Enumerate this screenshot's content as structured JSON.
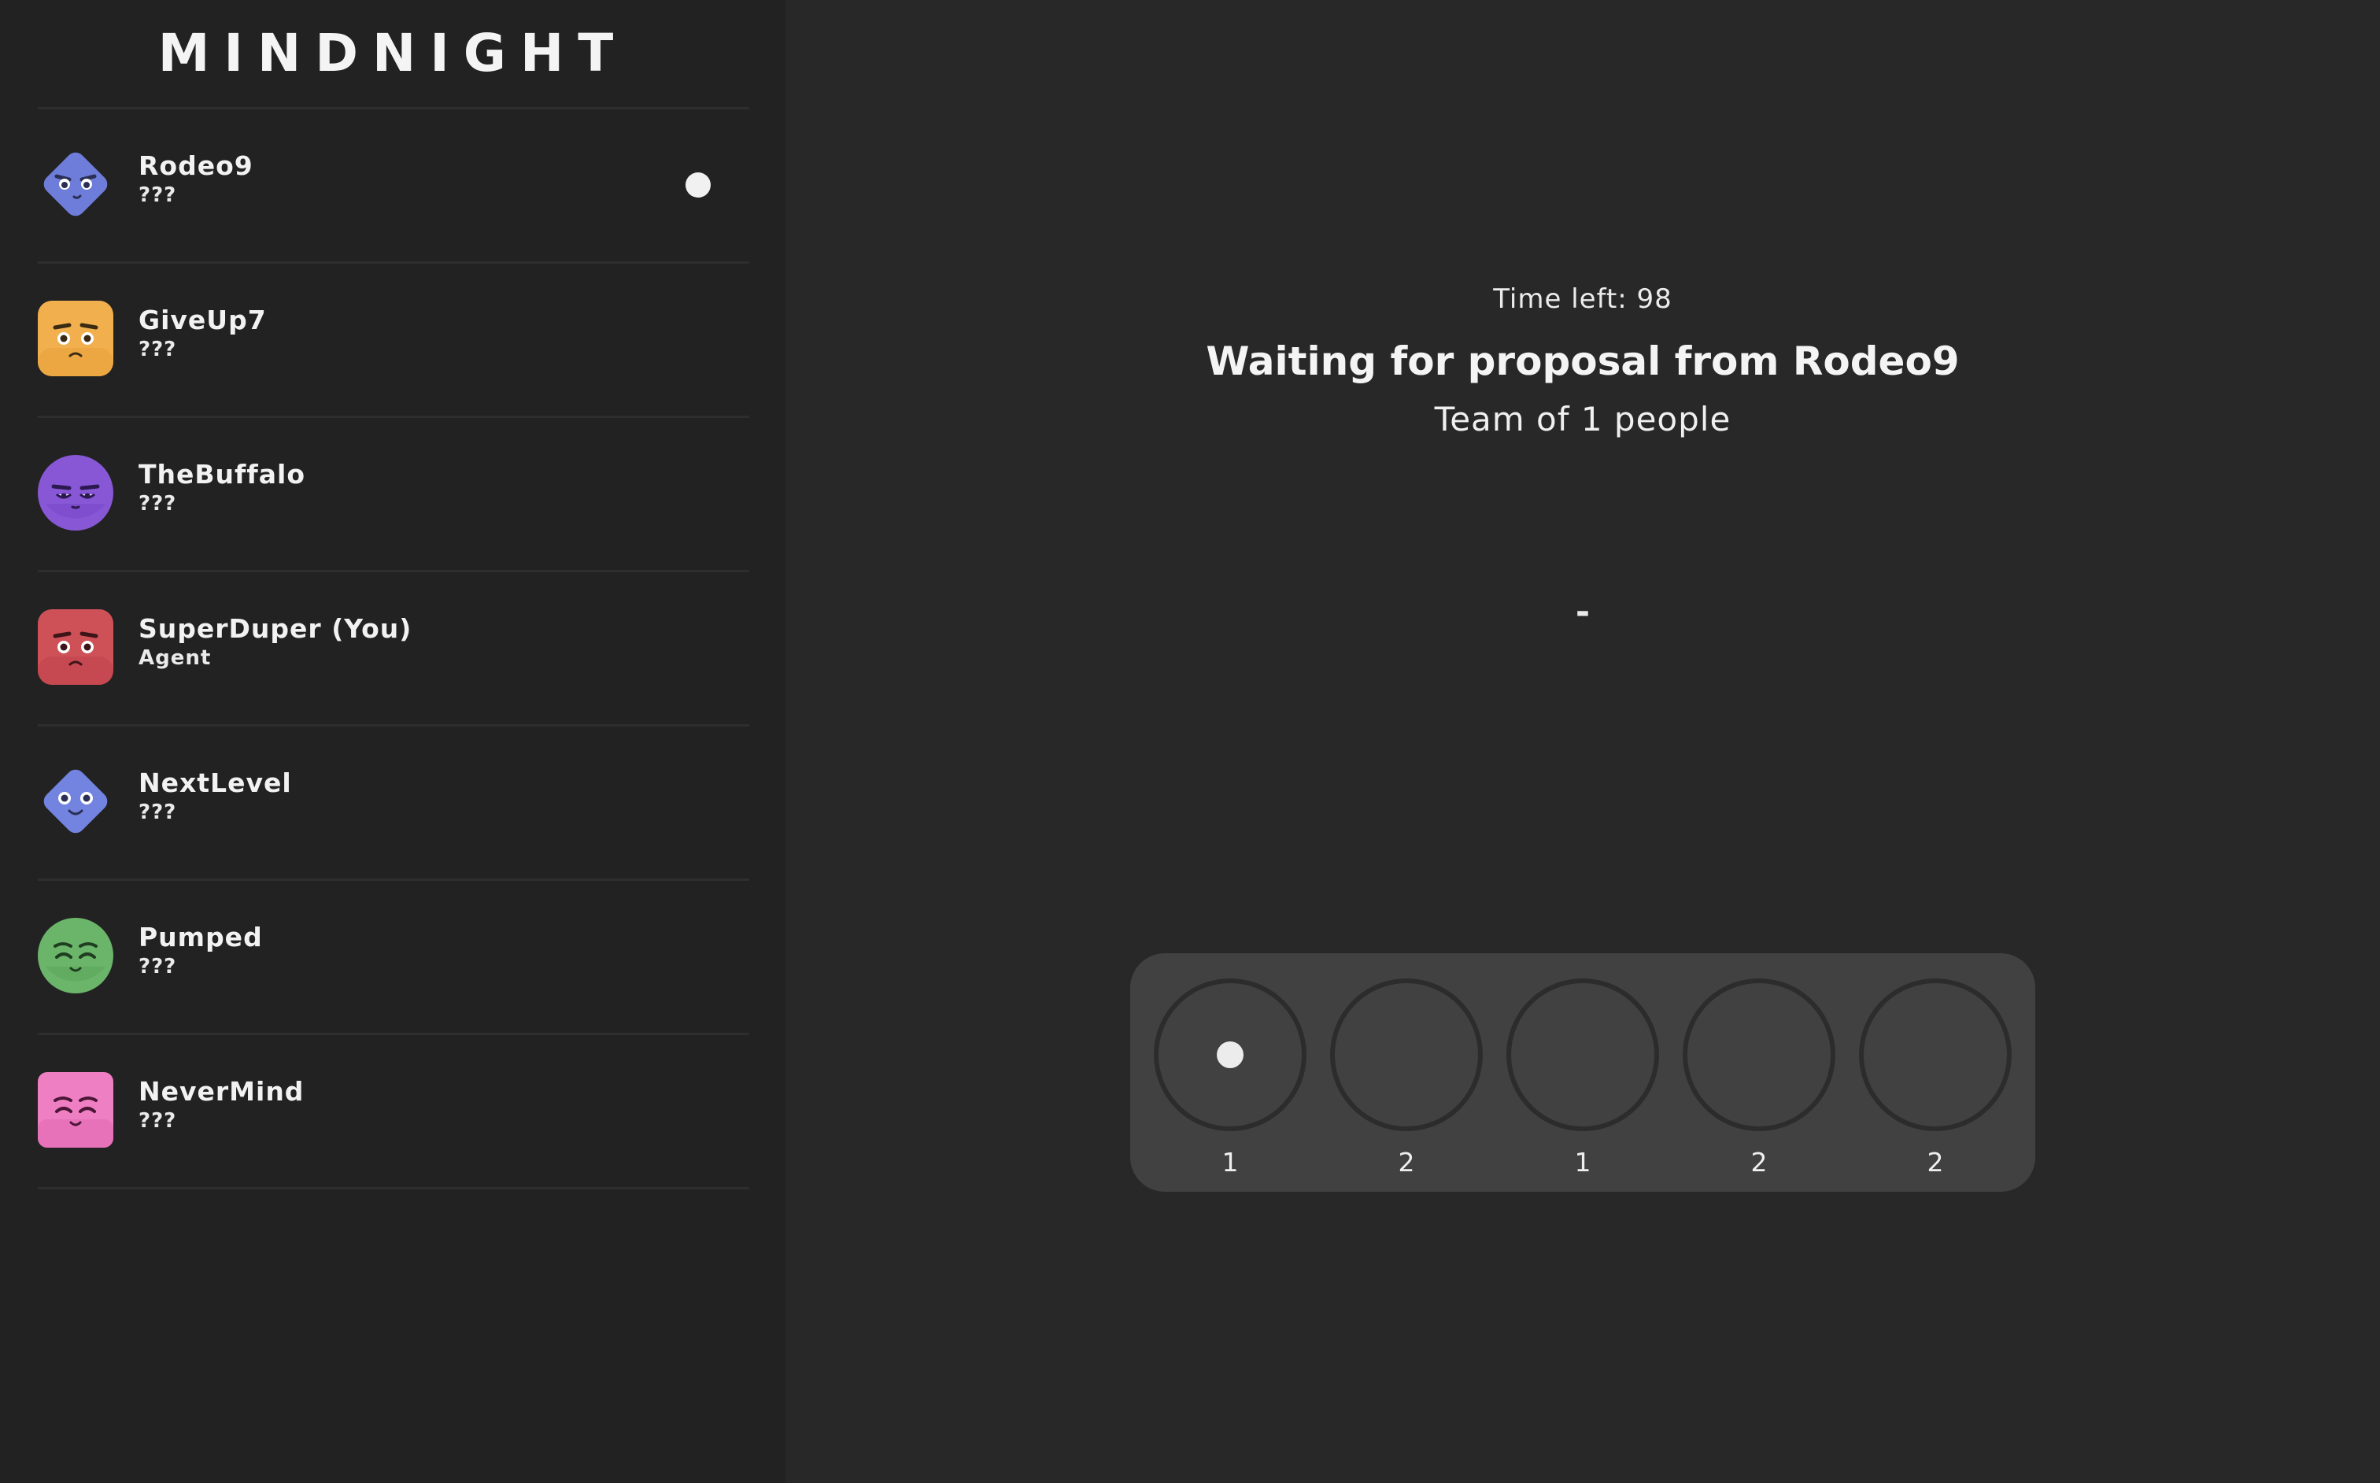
{
  "app": {
    "title": "MINDNIGHT"
  },
  "players": [
    {
      "name": "Rodeo9",
      "role": "???",
      "avatar": "blue-diamond-angry-face-icon",
      "color": "#7384e0",
      "is_leader": true
    },
    {
      "name": "GiveUp7",
      "role": "???",
      "avatar": "orange-square-worried-face-icon",
      "color": "#f1b04d",
      "is_leader": false
    },
    {
      "name": "TheBuffalo",
      "role": "???",
      "avatar": "purple-circle-sleepy-face-icon",
      "color": "#8857d6",
      "is_leader": false
    },
    {
      "name": "SuperDuper (You)",
      "role": "Agent",
      "avatar": "red-square-worried-face-icon",
      "color": "#cf5158",
      "is_leader": false
    },
    {
      "name": "NextLevel",
      "role": "???",
      "avatar": "blue-diamond-neutral-face-icon",
      "color": "#7384e0",
      "is_leader": false
    },
    {
      "name": "Pumped",
      "role": "???",
      "avatar": "green-circle-happy-face-icon",
      "color": "#6bb56a",
      "is_leader": false
    },
    {
      "name": "NeverMind",
      "role": "???",
      "avatar": "pink-square-happy-face-icon",
      "color": "#ee7fc3",
      "is_leader": false
    }
  ],
  "main": {
    "timer": "Time left: 98",
    "status": "Waiting for proposal from Rodeo9",
    "team_size": "Team of 1 people",
    "proposal": "-"
  },
  "missions": [
    {
      "size": "1",
      "current": true
    },
    {
      "size": "2",
      "current": false
    },
    {
      "size": "1",
      "current": false
    },
    {
      "size": "2",
      "current": false
    },
    {
      "size": "2",
      "current": false
    }
  ],
  "colors": {
    "sidebar_bg": "#222222",
    "main_bg": "#282828",
    "panel_bg": "#414141",
    "text": "#f2f2f2"
  }
}
